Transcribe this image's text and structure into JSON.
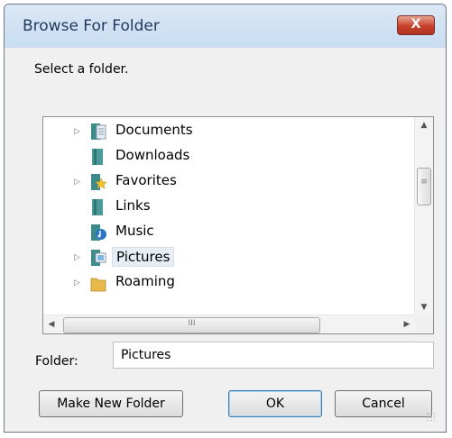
{
  "window": {
    "title": "Browse For Folder",
    "close_glyph": "X"
  },
  "prompt": "Select a folder.",
  "tree": {
    "items": [
      {
        "label": "Documents",
        "icon": "documents-folder-icon",
        "expandable": true,
        "selected": false
      },
      {
        "label": "Downloads",
        "icon": "folder-icon",
        "expandable": false,
        "selected": false
      },
      {
        "label": "Favorites",
        "icon": "favorites-folder-icon",
        "expandable": true,
        "selected": false
      },
      {
        "label": "Links",
        "icon": "folder-icon",
        "expandable": false,
        "selected": false
      },
      {
        "label": "Music",
        "icon": "music-folder-icon",
        "expandable": false,
        "selected": false
      },
      {
        "label": "Pictures",
        "icon": "pictures-folder-icon",
        "expandable": true,
        "selected": true
      },
      {
        "label": "Roaming",
        "icon": "folder-icon",
        "expandable": true,
        "selected": false
      }
    ],
    "expander_glyph": "▷",
    "scroll_up_glyph": "▲",
    "scroll_down_glyph": "▼",
    "scroll_left_glyph": "◀",
    "scroll_right_glyph": "▶",
    "thumb_grip_glyph": "≡",
    "hthumb_grip_glyph": "III"
  },
  "folder_field": {
    "label": "Folder:",
    "value": "Pictures"
  },
  "buttons": {
    "make_new_folder": "Make New Folder",
    "ok": "OK",
    "cancel": "Cancel"
  },
  "colors": {
    "titlebar": "#c9dcf1",
    "close": "#c6412c",
    "selection": "#e8eef6"
  }
}
